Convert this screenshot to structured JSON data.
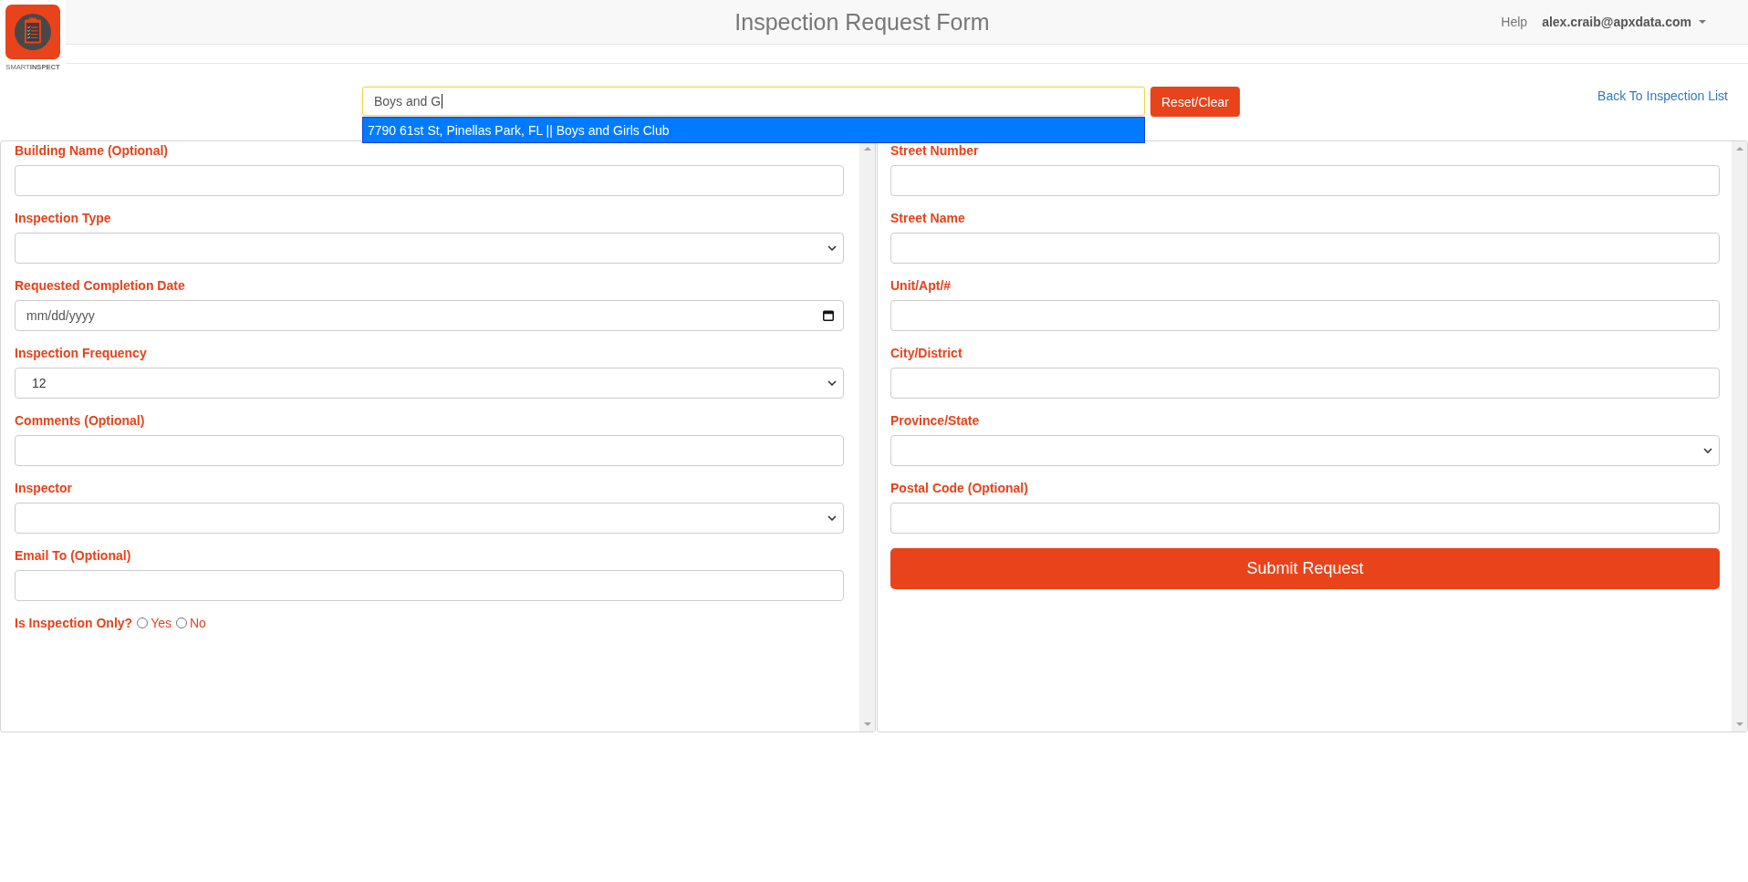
{
  "logo": {
    "text": "SMART**INSPECT**"
  },
  "header": {
    "title": "Inspection Request Form",
    "help_link": "Help",
    "user_menu": "alex.craib@apxdata.com"
  },
  "search": {
    "value": "Boys and G",
    "focused": true,
    "suggestions": [
      {
        "label": "7790 61st St, Pinellas Park, FL || Boys and Girls Club",
        "selected": true
      }
    ]
  },
  "reset_button": "Reset/Clear",
  "back_link": "Back To Inspection List",
  "left_fields": [
    {
      "label": "Building Name (Optional)",
      "kind": "text"
    },
    {
      "label": "Inspection Type",
      "kind": "select"
    },
    {
      "label": "Requested Completion Date",
      "kind": "date",
      "placeholder": "mm/dd/yyyy"
    },
    {
      "label": "Inspection Frequency",
      "kind": "select",
      "value": "12"
    },
    {
      "label": "Comments (Optional)",
      "kind": "text"
    },
    {
      "label": "Inspector",
      "kind": "select"
    },
    {
      "label": "Email To (Optional)",
      "kind": "text"
    },
    {
      "label": "Is Inspection Only?",
      "kind": "radio",
      "options": [
        {
          "label": "Yes",
          "selected": false
        },
        {
          "label": "No",
          "selected": false
        }
      ]
    }
  ],
  "right_fields": [
    {
      "label": "Street Number",
      "kind": "text"
    },
    {
      "label": "Street Name",
      "kind": "text"
    },
    {
      "label": "Unit/Apt/#",
      "kind": "text"
    },
    {
      "label": "City/District",
      "kind": "text"
    },
    {
      "label": "Province/State",
      "kind": "select"
    },
    {
      "label": "Postal Code (Optional)",
      "kind": "text"
    }
  ],
  "submit_button": "Submit Request"
}
